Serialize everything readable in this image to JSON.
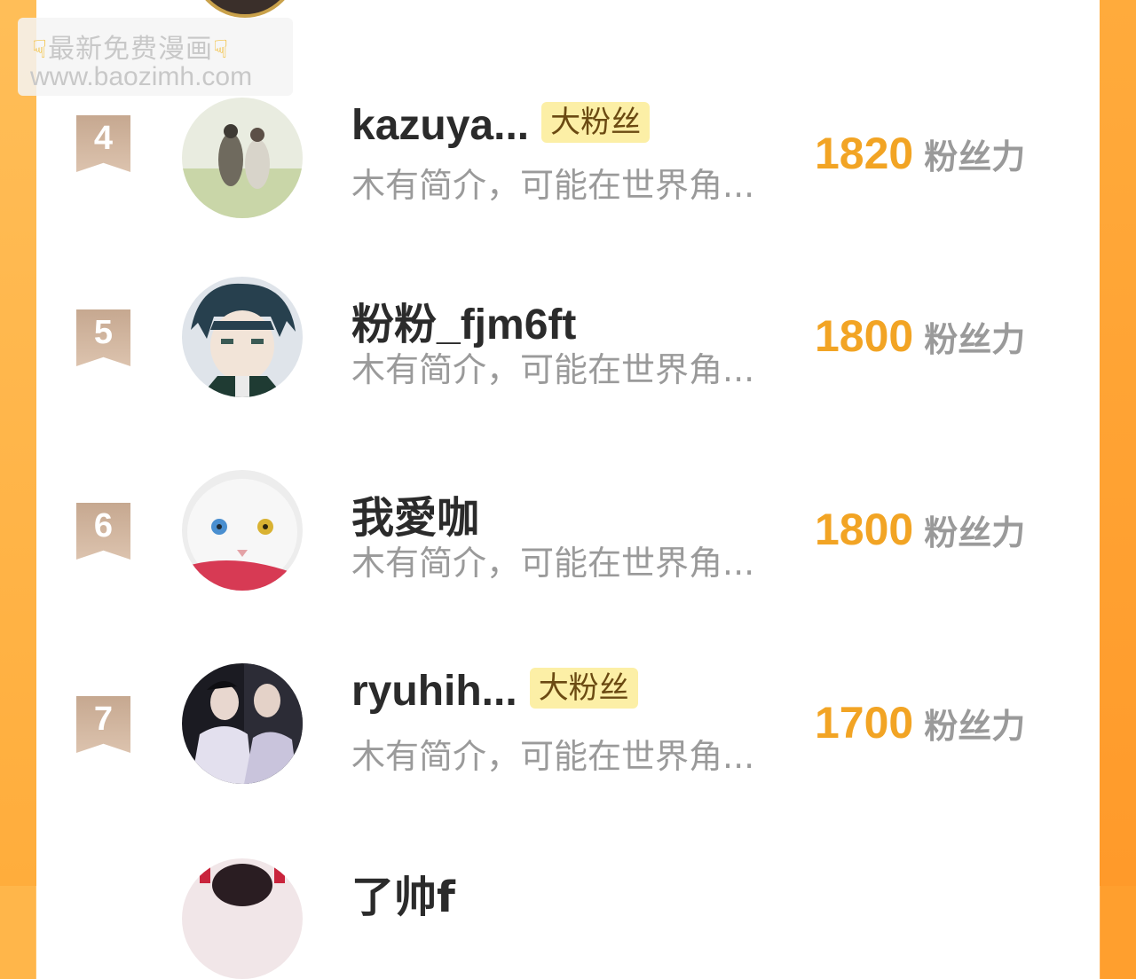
{
  "watermark": {
    "line1": "最新免费漫画",
    "line2": "www.baozimh.com"
  },
  "rows": [
    {
      "rank": "4",
      "name": "kazuya...",
      "badge": "大粉丝",
      "bio": "木有简介，可能在世界角...",
      "score": "1820",
      "unit": "粉丝力"
    },
    {
      "rank": "5",
      "name": "粉粉_fjm6ft",
      "badge": "",
      "bio": "木有简介，可能在世界角...",
      "score": "1800",
      "unit": "粉丝力"
    },
    {
      "rank": "6",
      "name": "我愛咖",
      "badge": "",
      "bio": "木有简介，可能在世界角...",
      "score": "1800",
      "unit": "粉丝力"
    },
    {
      "rank": "7",
      "name": "ryuhih...",
      "badge": "大粉丝",
      "bio": "木有简介，可能在世界角...",
      "score": "1700",
      "unit": "粉丝力"
    }
  ],
  "partial_row": {
    "name": "了帅f"
  },
  "colors": {
    "accent": "#f2a424",
    "badge_bg": "#fcefa6",
    "rank_ribbon": "#c6a890",
    "side_bar": "#ffa83a"
  }
}
